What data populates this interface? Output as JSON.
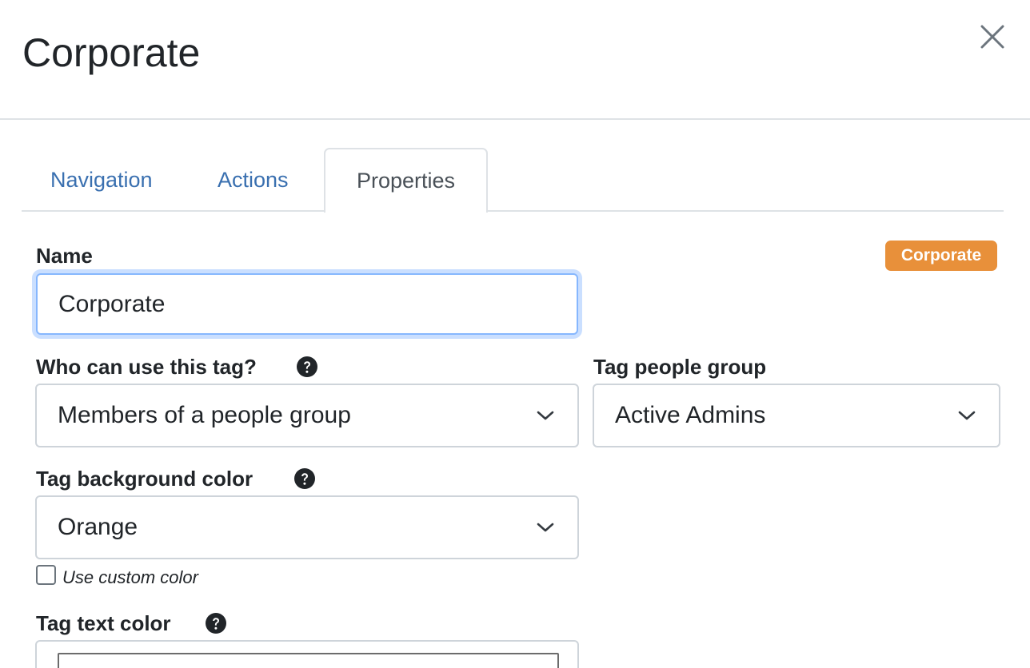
{
  "header": {
    "title": "Corporate",
    "close_label": "close"
  },
  "tabs": [
    {
      "label": "Navigation",
      "active": false
    },
    {
      "label": "Actions",
      "active": false
    },
    {
      "label": "Properties",
      "active": true
    }
  ],
  "form": {
    "name": {
      "label": "Name",
      "value": "Corporate"
    },
    "preview_badge": {
      "text": "Corporate",
      "color": "#e8903a"
    },
    "who_can_use": {
      "label": "Who can use this tag?",
      "selected": "Members of a people group"
    },
    "people_group": {
      "label": "Tag people group",
      "selected": "Active Admins"
    },
    "background_color": {
      "label": "Tag background color",
      "selected": "Orange"
    },
    "custom_color": {
      "label": "Use custom color",
      "checked": false
    },
    "text_color": {
      "label": "Tag text color",
      "value": "#ffffff"
    }
  },
  "colors": {
    "link": "#3a70b0",
    "accent_focus": "#86b7fe",
    "border": "#dee2e6",
    "badge_orange": "#e8903a"
  },
  "icons": {
    "close": "close-icon",
    "help": "question-circle-icon",
    "chevron": "chevron-down-icon"
  }
}
